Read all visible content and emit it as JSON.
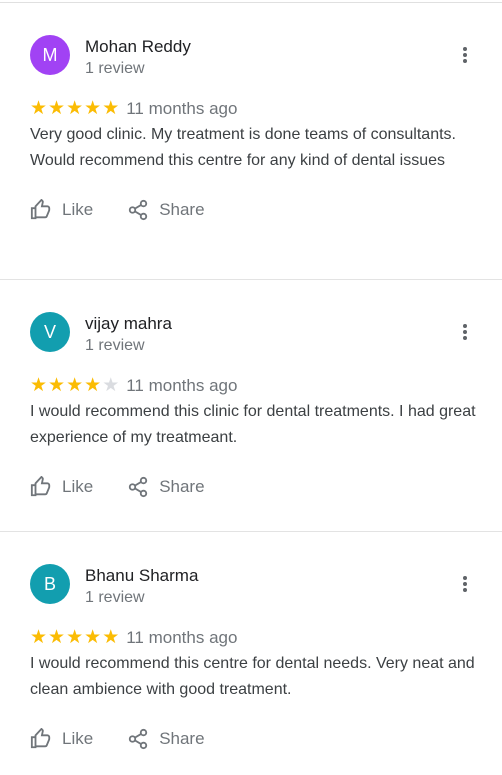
{
  "colors": {
    "star": "#fbbc04",
    "star_empty": "#dadce0",
    "meta": "#70757a"
  },
  "reviews": [
    {
      "initial": "M",
      "avatar_color": "#a142f4",
      "author": "Mohan Reddy",
      "review_count": "1 review",
      "stars": 5,
      "time": "11 months ago",
      "text": "Very good clinic. My treatment is done teams of consultants. Would recommend this centre for any kind of dental issues",
      "like_label": "Like",
      "share_label": "Share"
    },
    {
      "initial": "V",
      "avatar_color": "#129eaf",
      "author": "vijay mahra",
      "review_count": "1 review",
      "stars": 4,
      "time": "11 months ago",
      "text": "I would recommend this clinic for dental treatments. I had great experience of my treatmeant.",
      "like_label": "Like",
      "share_label": "Share"
    },
    {
      "initial": "B",
      "avatar_color": "#129eaf",
      "author": "Bhanu Sharma",
      "review_count": "1 review",
      "stars": 5,
      "time": "11 months ago",
      "text": "I would recommend this centre for dental needs. Very neat and clean ambience with good treatment.",
      "like_label": "Like",
      "share_label": "Share"
    }
  ]
}
